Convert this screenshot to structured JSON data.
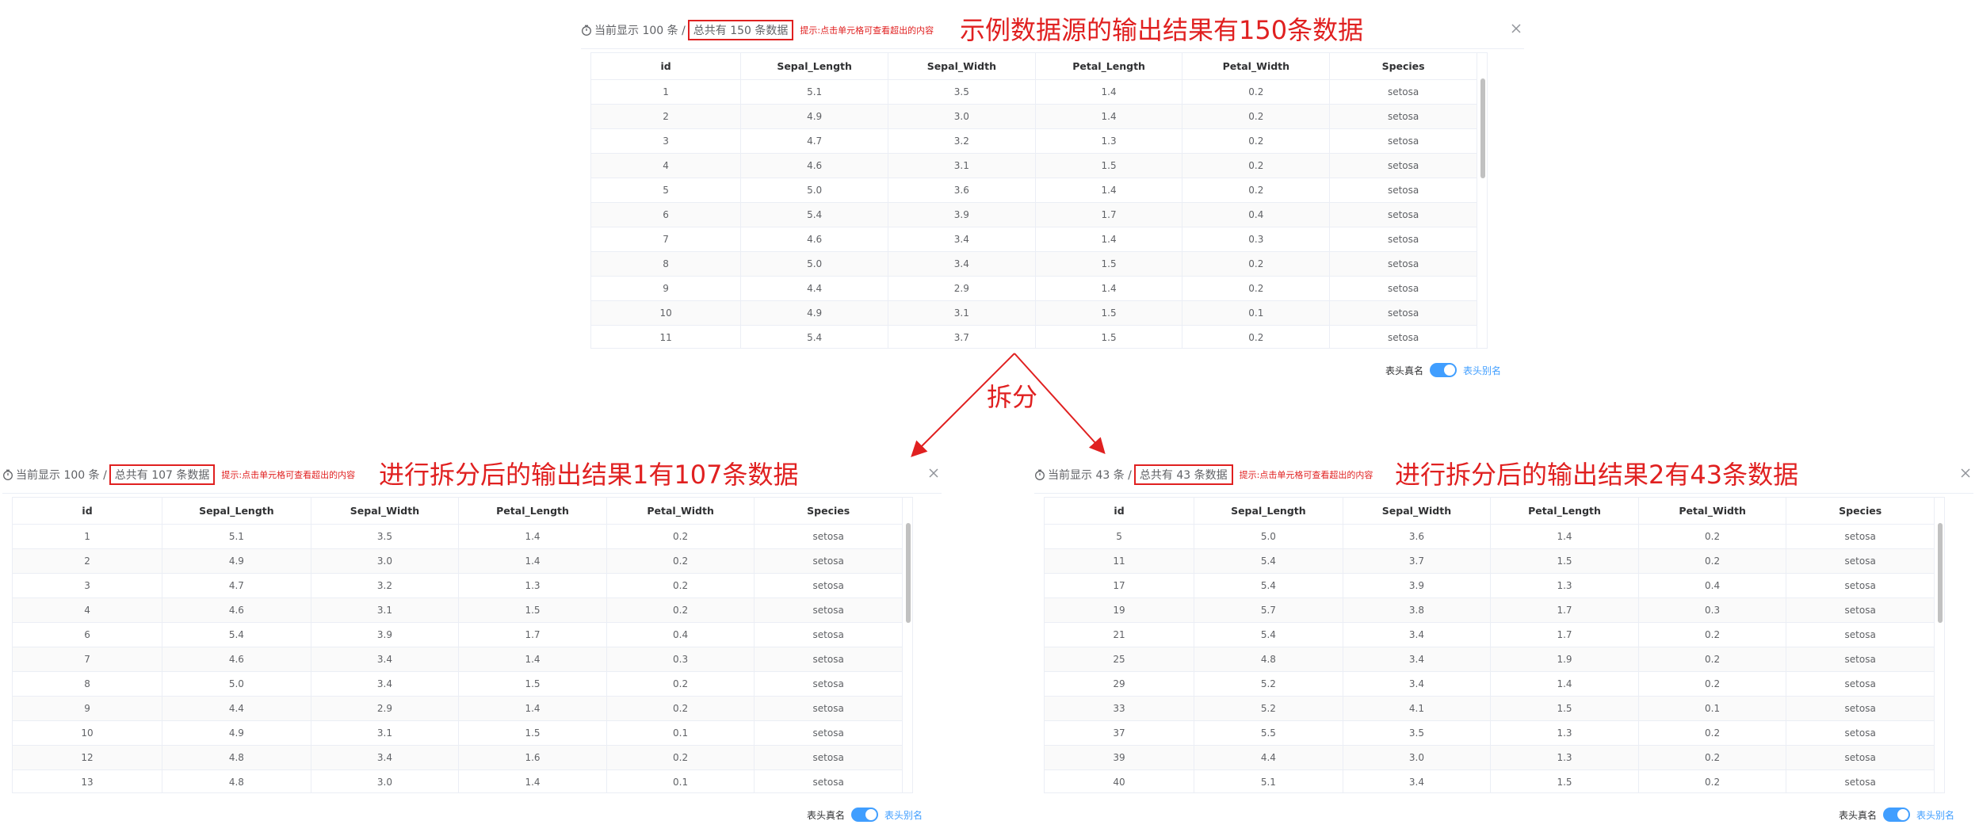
{
  "colors": {
    "accent_red": "#e02020",
    "switch_blue": "#409eff",
    "border": "#ebeef5"
  },
  "columns": [
    "id",
    "Sepal_Length",
    "Sepal_Width",
    "Petal_Length",
    "Petal_Width",
    "Species"
  ],
  "hint_text": "提示:点击单元格可查看超出的内容",
  "switch": {
    "left_label": "表头真名",
    "right_label": "表头别名",
    "on": true
  },
  "split_label": "拆分",
  "panels": [
    {
      "id": "source",
      "showing_text": "当前显示 100 条 /",
      "total_text": "总共有 150 条数据",
      "annotation": "示例数据源的输出结果有150条数据",
      "rows": [
        [
          "1",
          "5.1",
          "3.5",
          "1.4",
          "0.2",
          "setosa"
        ],
        [
          "2",
          "4.9",
          "3.0",
          "1.4",
          "0.2",
          "setosa"
        ],
        [
          "3",
          "4.7",
          "3.2",
          "1.3",
          "0.2",
          "setosa"
        ],
        [
          "4",
          "4.6",
          "3.1",
          "1.5",
          "0.2",
          "setosa"
        ],
        [
          "5",
          "5.0",
          "3.6",
          "1.4",
          "0.2",
          "setosa"
        ],
        [
          "6",
          "5.4",
          "3.9",
          "1.7",
          "0.4",
          "setosa"
        ],
        [
          "7",
          "4.6",
          "3.4",
          "1.4",
          "0.3",
          "setosa"
        ],
        [
          "8",
          "5.0",
          "3.4",
          "1.5",
          "0.2",
          "setosa"
        ],
        [
          "9",
          "4.4",
          "2.9",
          "1.4",
          "0.2",
          "setosa"
        ],
        [
          "10",
          "4.9",
          "3.1",
          "1.5",
          "0.1",
          "setosa"
        ],
        [
          "11",
          "5.4",
          "3.7",
          "1.5",
          "0.2",
          "setosa"
        ]
      ]
    },
    {
      "id": "split1",
      "showing_text": "当前显示 100 条 /",
      "total_text": "总共有 107 条数据",
      "annotation": "进行拆分后的输出结果1有107条数据",
      "rows": [
        [
          "1",
          "5.1",
          "3.5",
          "1.4",
          "0.2",
          "setosa"
        ],
        [
          "2",
          "4.9",
          "3.0",
          "1.4",
          "0.2",
          "setosa"
        ],
        [
          "3",
          "4.7",
          "3.2",
          "1.3",
          "0.2",
          "setosa"
        ],
        [
          "4",
          "4.6",
          "3.1",
          "1.5",
          "0.2",
          "setosa"
        ],
        [
          "6",
          "5.4",
          "3.9",
          "1.7",
          "0.4",
          "setosa"
        ],
        [
          "7",
          "4.6",
          "3.4",
          "1.4",
          "0.3",
          "setosa"
        ],
        [
          "8",
          "5.0",
          "3.4",
          "1.5",
          "0.2",
          "setosa"
        ],
        [
          "9",
          "4.4",
          "2.9",
          "1.4",
          "0.2",
          "setosa"
        ],
        [
          "10",
          "4.9",
          "3.1",
          "1.5",
          "0.1",
          "setosa"
        ],
        [
          "12",
          "4.8",
          "3.4",
          "1.6",
          "0.2",
          "setosa"
        ],
        [
          "13",
          "4.8",
          "3.0",
          "1.4",
          "0.1",
          "setosa"
        ]
      ]
    },
    {
      "id": "split2",
      "showing_text": "当前显示 43 条 /",
      "total_text": "总共有 43 条数据",
      "annotation": "进行拆分后的输出结果2有43条数据",
      "rows": [
        [
          "5",
          "5.0",
          "3.6",
          "1.4",
          "0.2",
          "setosa"
        ],
        [
          "11",
          "5.4",
          "3.7",
          "1.5",
          "0.2",
          "setosa"
        ],
        [
          "17",
          "5.4",
          "3.9",
          "1.3",
          "0.4",
          "setosa"
        ],
        [
          "19",
          "5.7",
          "3.8",
          "1.7",
          "0.3",
          "setosa"
        ],
        [
          "21",
          "5.4",
          "3.4",
          "1.7",
          "0.2",
          "setosa"
        ],
        [
          "25",
          "4.8",
          "3.4",
          "1.9",
          "0.2",
          "setosa"
        ],
        [
          "29",
          "5.2",
          "3.4",
          "1.4",
          "0.2",
          "setosa"
        ],
        [
          "33",
          "5.2",
          "4.1",
          "1.5",
          "0.1",
          "setosa"
        ],
        [
          "37",
          "5.5",
          "3.5",
          "1.3",
          "0.2",
          "setosa"
        ],
        [
          "39",
          "4.4",
          "3.0",
          "1.3",
          "0.2",
          "setosa"
        ],
        [
          "40",
          "5.1",
          "3.4",
          "1.5",
          "0.2",
          "setosa"
        ]
      ]
    }
  ]
}
